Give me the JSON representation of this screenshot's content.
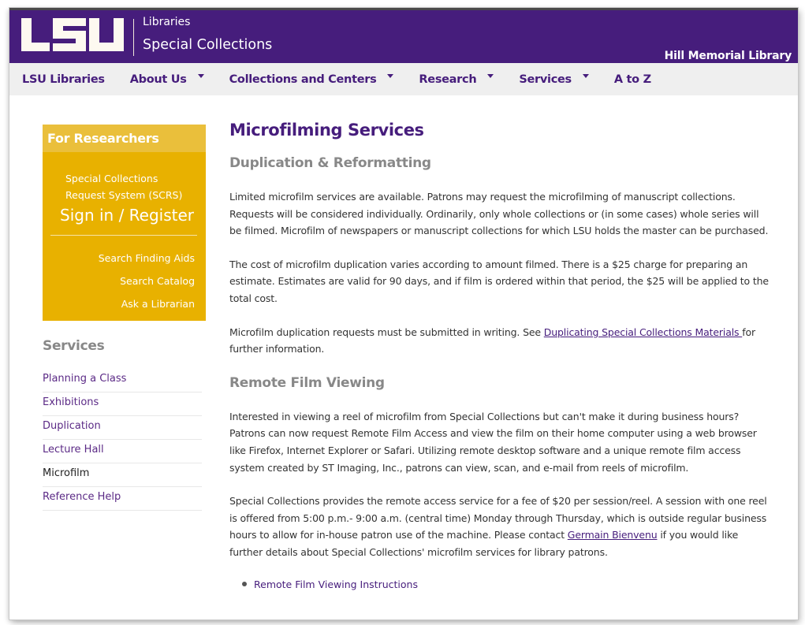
{
  "header": {
    "logo_text": "LSU",
    "site_superscript": "Libraries",
    "site_title": "Special Collections",
    "library_name": "Hill Memorial Library",
    "brand_color": "#461d7c"
  },
  "nav": {
    "items": [
      {
        "label": "LSU Libraries",
        "has_dropdown": false
      },
      {
        "label": "About Us",
        "has_dropdown": true
      },
      {
        "label": "Collections and Centers",
        "has_dropdown": true
      },
      {
        "label": "Research",
        "has_dropdown": true
      },
      {
        "label": "Services",
        "has_dropdown": true
      },
      {
        "label": "A to Z",
        "has_dropdown": false
      }
    ]
  },
  "sidebar": {
    "researchers": {
      "heading": "For Researchers",
      "scrs_line1": "Special Collections",
      "scrs_line2": "Request System (SCRS)",
      "signin": "Sign in / Register",
      "links": [
        "Search Finding Aids",
        "Search Catalog",
        "Ask a Librarian"
      ],
      "accent_color": "#e8b100"
    },
    "services": {
      "heading": "Services",
      "items": [
        {
          "label": "Planning a Class",
          "current": false
        },
        {
          "label": "Exhibitions",
          "current": false
        },
        {
          "label": "Duplication",
          "current": false
        },
        {
          "label": "Lecture Hall",
          "current": false
        },
        {
          "label": "Microfilm",
          "current": true
        },
        {
          "label": "Reference Help",
          "current": false
        }
      ]
    }
  },
  "main": {
    "title": "Microfilming Services",
    "section1": {
      "heading": "Duplication & Reformatting",
      "p1": "Limited microfilm services are available. Patrons may request the microfilming of manuscript collections. Requests will be considered individually. Ordinarily, only whole collections or (in some cases) whole series will be filmed. Microfilm of newspapers or manuscript collections for which LSU holds the master can be purchased.",
      "p2": "The cost of microfilm duplication varies according to amount filmed. There is a $25 charge for preparing an estimate. Estimates are valid for 90 days, and if film is ordered within that period, the $25 will be applied to the total cost.",
      "p3_before": "Microfilm duplication requests must be submitted in writing. See ",
      "p3_link": "Duplicating Special Collections Materials ",
      "p3_after": "for further information."
    },
    "section2": {
      "heading": "Remote Film Viewing",
      "p1": "Interested in viewing a reel of microfilm from Special Collections but can't make it during business hours? Patrons can now request Remote Film Access and view the film on their home computer using a web browser like Firefox, Internet Explorer or Safari. Utilizing remote desktop software and a unique remote film access system created by ST Imaging, Inc., patrons can view, scan, and e-mail from reels of microfilm.",
      "p2_before": "Special Collections provides the remote access service for a fee of $20 per session/reel. A session with one reel is offered from 5:00 p.m.- 9:00 a.m. (central time) Monday through Thursday, which is outside regular business hours to allow for in-house patron use of the machine.  Please contact ",
      "p2_link": "Germain Bienvenu",
      "p2_after": " if you would like further details about Special Collections' microfilm services for library patrons.",
      "bullets": [
        "Remote Film Viewing Instructions"
      ]
    }
  }
}
